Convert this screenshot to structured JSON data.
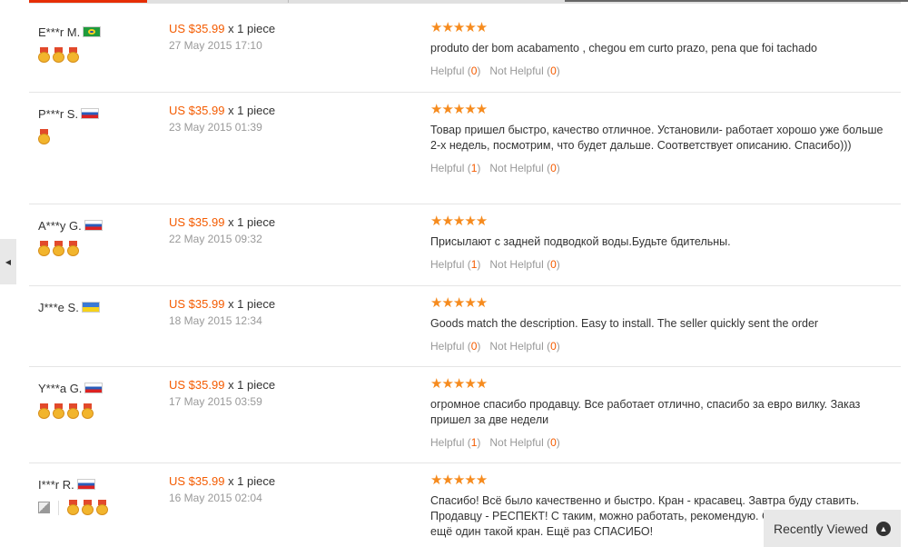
{
  "colors": {
    "accent": "#f45b00",
    "star": "#f68b1e",
    "muted": "#999999"
  },
  "side_nav": {
    "icon": "chevron-left-icon",
    "glyph": "◀"
  },
  "feedback": [
    {
      "buyer": "E***r M.",
      "country": "br",
      "medals": 3,
      "has_photo": false,
      "price": "US $35.99",
      "quantity": "x 1 piece",
      "date": "27 May 2015 17:10",
      "stars": "★★★★★",
      "comment": "produto der bom acabamento , chegou em curto prazo, pena que foi tachado",
      "helpful_label": "Helpful",
      "helpful_count": "0",
      "not_helpful_label": "Not Helpful",
      "not_helpful_count": "0"
    },
    {
      "buyer": "P***r S.",
      "country": "ru",
      "medals": 1,
      "has_photo": false,
      "price": "US $35.99",
      "quantity": "x 1 piece",
      "date": "23 May 2015 01:39",
      "stars": "★★★★★",
      "comment": "Товар пришел быстро, качество отличное. Установили- работает хорошо уже больше 2-х недель, посмотрим, что будет дальше. Соответствует описанию. Спасибо)))",
      "helpful_label": "Helpful",
      "helpful_count": "1",
      "not_helpful_label": "Not Helpful",
      "not_helpful_count": "0"
    },
    {
      "buyer": "A***y G.",
      "country": "ru",
      "medals": 3,
      "has_photo": false,
      "price": "US $35.99",
      "quantity": "x 1 piece",
      "date": "22 May 2015 09:32",
      "stars": "★★★★★",
      "comment": "Присылают с задней подводкой воды.Будьте бдительны.",
      "helpful_label": "Helpful",
      "helpful_count": "1",
      "not_helpful_label": "Not Helpful",
      "not_helpful_count": "0"
    },
    {
      "buyer": "J***e S.",
      "country": "ua",
      "medals": 0,
      "has_photo": false,
      "price": "US $35.99",
      "quantity": "x 1 piece",
      "date": "18 May 2015 12:34",
      "stars": "★★★★★",
      "comment": "Goods match the description. Easy to install. The seller quickly sent the order",
      "helpful_label": "Helpful",
      "helpful_count": "0",
      "not_helpful_label": "Not Helpful",
      "not_helpful_count": "0"
    },
    {
      "buyer": "Y***a G.",
      "country": "ru",
      "medals": 4,
      "has_photo": false,
      "price": "US $35.99",
      "quantity": "x 1 piece",
      "date": "17 May 2015 03:59",
      "stars": "★★★★★",
      "comment": "огромное спасибо продавцу. Все работает отлично, спасибо за евро вилку. Заказ пришел за две недели",
      "helpful_label": "Helpful",
      "helpful_count": "1",
      "not_helpful_label": "Not Helpful",
      "not_helpful_count": "0"
    },
    {
      "buyer": "I***r R.",
      "country": "ru",
      "medals": 3,
      "has_photo": true,
      "price": "US $35.99",
      "quantity": "x 1 piece",
      "date": "16 May 2015 02:04",
      "stars": "★★★★★",
      "comment": "Спасибо! Всё было качественно и быстро. Кран - красавец. Завтра буду ставить. Продавцу - РЕСПЕКТ! С таким, можно работать, рекомендую. С Вами буду заказывать ещё один такой кран. Ещё раз СПАСИБО!",
      "helpful_label": "",
      "helpful_count": "",
      "not_helpful_label": "",
      "not_helpful_count": ""
    }
  ],
  "recently_viewed": {
    "label": "Recently Viewed",
    "icon": "chevron-up-icon",
    "glyph": "▲"
  }
}
